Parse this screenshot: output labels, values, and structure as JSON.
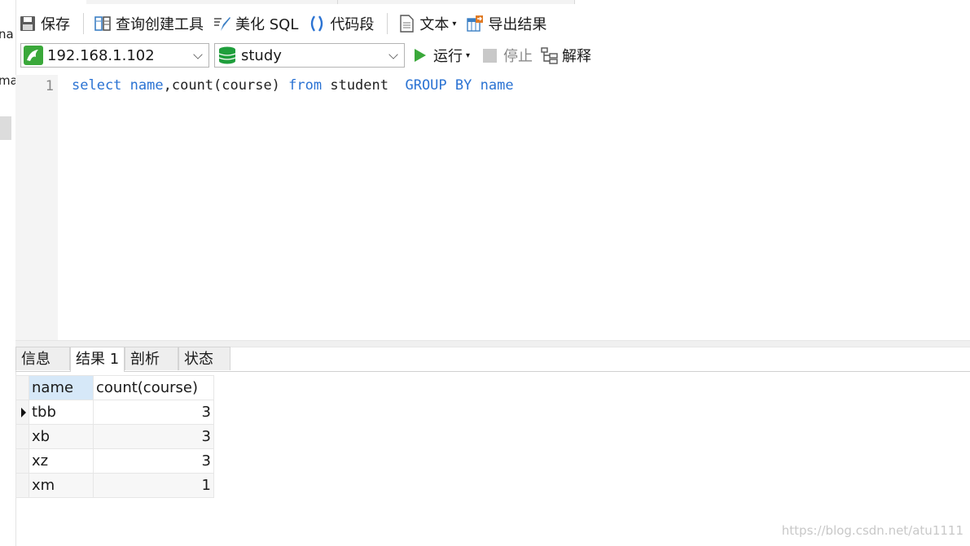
{
  "left_strip": {
    "text1": "na",
    "text2": "ma"
  },
  "toolbar": {
    "save": "保存",
    "query_builder": "查询创建工具",
    "beautify_sql": "美化 SQL",
    "code_snippet": "代码段",
    "text": "文本",
    "export_results": "导出结果"
  },
  "connection": {
    "host": "192.168.1.102",
    "database": "study",
    "run": "运行",
    "stop": "停止",
    "explain": "解释"
  },
  "editor": {
    "line_number": "1",
    "tokens": [
      {
        "t": "select",
        "kw": true
      },
      {
        "t": " ",
        "kw": false
      },
      {
        "t": "name",
        "kw": true
      },
      {
        "t": ",count(course) ",
        "kw": false
      },
      {
        "t": "from",
        "kw": true
      },
      {
        "t": " student  ",
        "kw": false
      },
      {
        "t": "GROUP BY",
        "kw": true
      },
      {
        "t": " ",
        "kw": false
      },
      {
        "t": "name",
        "kw": true
      }
    ]
  },
  "tabs": [
    "信息",
    "结果 1",
    "剖析",
    "状态"
  ],
  "results": {
    "columns": [
      "name",
      "count(course)"
    ],
    "rows": [
      [
        "tbb",
        "3"
      ],
      [
        "xb",
        "3"
      ],
      [
        "xz",
        "3"
      ],
      [
        "xm",
        "1"
      ]
    ]
  },
  "watermark": "https://blog.csdn.net/atu1111",
  "colors": {
    "keyword": "#2b73d3",
    "run_green": "#3aa83a",
    "db_green": "#1f9e3c"
  }
}
